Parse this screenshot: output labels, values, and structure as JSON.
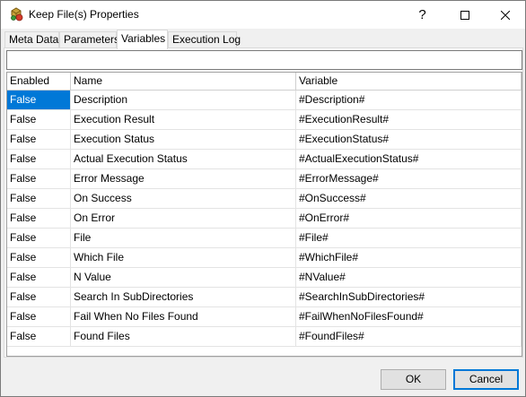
{
  "window": {
    "title": "Keep File(s) Properties"
  },
  "title_buttons": {
    "help": "?"
  },
  "tabs": [
    {
      "label": "Meta Data",
      "active": false
    },
    {
      "label": "Parameters",
      "active": false
    },
    {
      "label": "Variables",
      "active": true
    },
    {
      "label": "Execution Log",
      "active": false
    }
  ],
  "filter": {
    "value": "",
    "placeholder": ""
  },
  "grid": {
    "columns": [
      "Enabled",
      "Name",
      "Variable"
    ],
    "rows": [
      {
        "enabled": "False",
        "name": "Description",
        "variable": "#Description#",
        "selected": true
      },
      {
        "enabled": "False",
        "name": "Execution Result",
        "variable": "#ExecutionResult#"
      },
      {
        "enabled": "False",
        "name": "Execution Status",
        "variable": "#ExecutionStatus#"
      },
      {
        "enabled": "False",
        "name": "Actual Execution Status",
        "variable": "#ActualExecutionStatus#"
      },
      {
        "enabled": "False",
        "name": "Error Message",
        "variable": "#ErrorMessage#"
      },
      {
        "enabled": "False",
        "name": "On Success",
        "variable": "#OnSuccess#"
      },
      {
        "enabled": "False",
        "name": "On Error",
        "variable": "#OnError#"
      },
      {
        "enabled": "False",
        "name": "File",
        "variable": "#File#"
      },
      {
        "enabled": "False",
        "name": "Which File",
        "variable": "#WhichFile#"
      },
      {
        "enabled": "False",
        "name": "N Value",
        "variable": "#NValue#"
      },
      {
        "enabled": "False",
        "name": "Search In SubDirectories",
        "variable": "#SearchInSubDirectories#"
      },
      {
        "enabled": "False",
        "name": "Fail When No Files Found",
        "variable": "#FailWhenNoFilesFound#"
      },
      {
        "enabled": "False",
        "name": "Found Files",
        "variable": "#FoundFiles#"
      }
    ]
  },
  "buttons": {
    "ok": "OK",
    "cancel": "Cancel"
  },
  "colors": {
    "selection": "#0078d7",
    "window_bg": "#f0f0f0",
    "button_focus": "#0078d7"
  }
}
